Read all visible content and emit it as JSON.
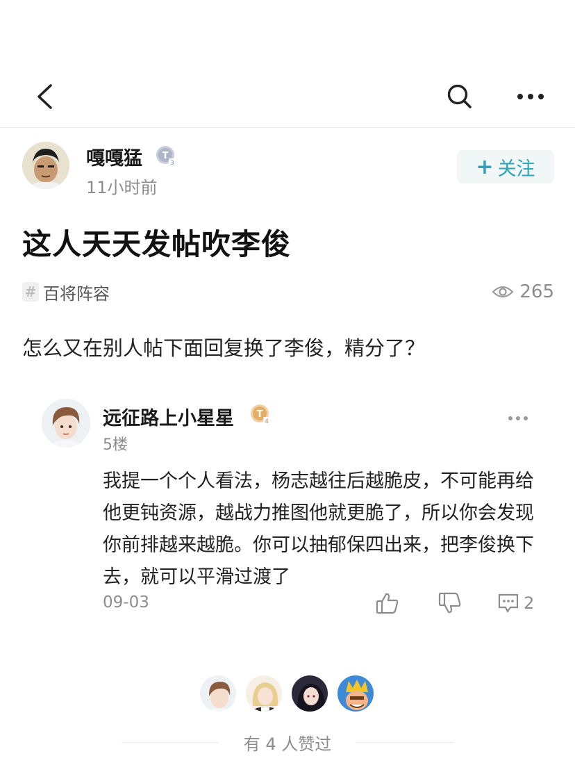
{
  "header": {
    "back_icon": "chevron-left-icon",
    "search_icon": "search-icon",
    "more_icon": "more-horizontal-icon"
  },
  "author": {
    "name": "嘎嘎猛",
    "level_badge": "T3",
    "time": "11小时前",
    "follow_label": "关注",
    "follow_plus": "+"
  },
  "post": {
    "title": "这人天天发帖吹李俊",
    "tag": "百将阵容",
    "tag_hash": "#",
    "views": "265",
    "body": "怎么又在别人帖下面回复换了李俊，精分了？"
  },
  "comment": {
    "name": "远征路上小星星",
    "level_badge": "T4",
    "floor": "5楼",
    "text": "我提一个个人看法，杨志越往后越脆皮，不可能再给他更钝资源，越战力推图他就更脆了，所以你会发现你前排越来越脆。你可以抽郁保四出来，把李俊换下去，就可以平滑过渡了",
    "date": "09-03",
    "reply_count": "2"
  },
  "likes": {
    "summary": "有 4 人赞过"
  },
  "colors": {
    "accent": "#2ca3b7",
    "follow_bg": "#f1f6f7",
    "muted": "#8c8c8c",
    "badge_silver": "#b9bfd0",
    "badge_gold": "#e8b56a"
  }
}
